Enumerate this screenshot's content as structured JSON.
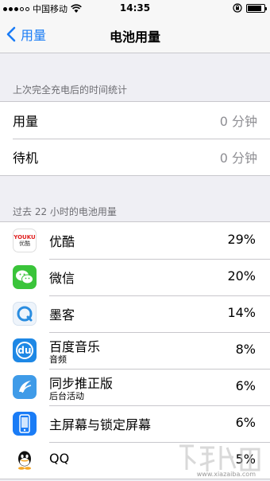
{
  "status_bar": {
    "carrier": "中国移动",
    "time": "14:35"
  },
  "nav": {
    "back_label": "用量",
    "title": "电池用量"
  },
  "since_charge": {
    "header": "上次完全充电后的时间统计",
    "rows": [
      {
        "label": "用量",
        "value": "0 分钟"
      },
      {
        "label": "待机",
        "value": "0 分钟"
      }
    ]
  },
  "usage": {
    "header": "过去 22 小时的电池用量",
    "apps": [
      {
        "name": "优酷",
        "sub": "",
        "percent": "29%",
        "icon": "youku-icon",
        "icon_text_top": "YOUKU",
        "icon_text_bottom": "优酷"
      },
      {
        "name": "微信",
        "sub": "",
        "percent": "20%",
        "icon": "wechat-icon"
      },
      {
        "name": "墨客",
        "sub": "",
        "percent": "14%",
        "icon": "moke-icon"
      },
      {
        "name": "百度音乐",
        "sub": "音频",
        "percent": "8%",
        "icon": "baidu-music-icon",
        "icon_text": "du"
      },
      {
        "name": "同步推正版",
        "sub": "后台活动",
        "percent": "6%",
        "icon": "tongbutui-icon"
      },
      {
        "name": "主屏幕与锁定屏幕",
        "sub": "",
        "percent": "6%",
        "icon": "home-lock-screen-icon"
      },
      {
        "name": "QQ",
        "sub": "",
        "percent": "5%",
        "icon": "qq-icon"
      }
    ]
  },
  "colors": {
    "accent": "#1a7cf6",
    "background": "#efeff4",
    "separator": "#c8c7cc",
    "secondary_text": "#8e8e93"
  },
  "watermark": {
    "url": "www.xiazaiba.com"
  }
}
